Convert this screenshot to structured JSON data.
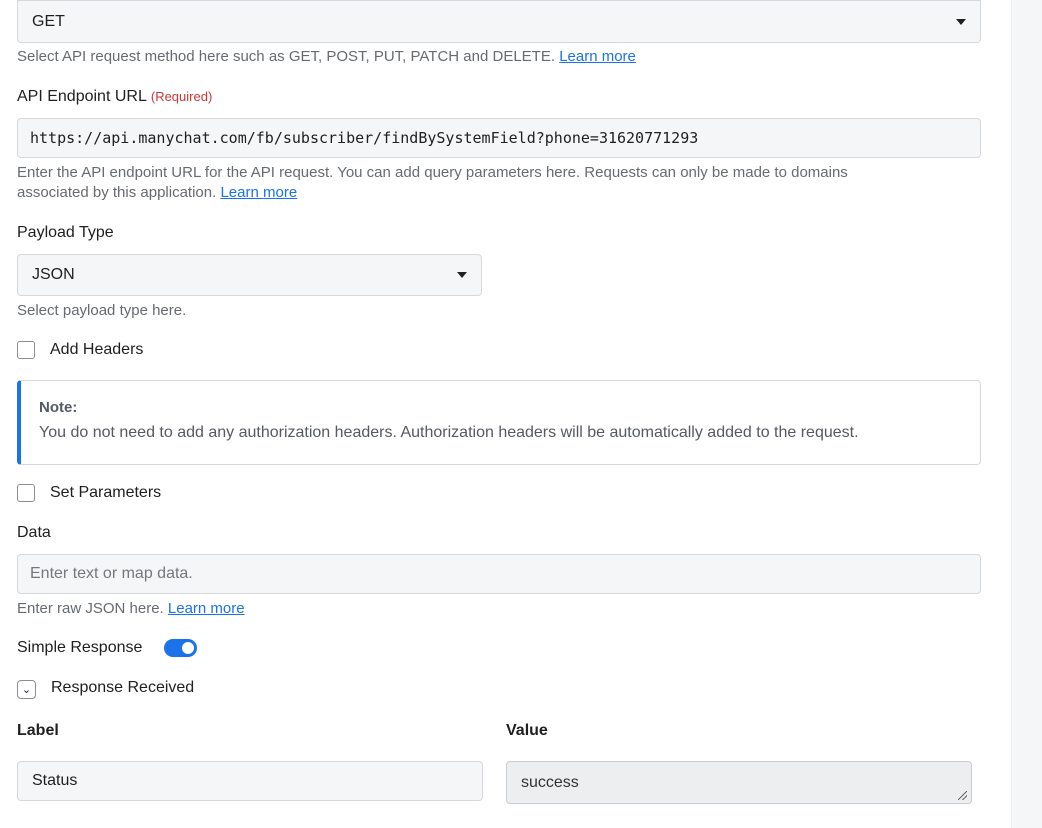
{
  "method": {
    "value": "GET",
    "hint": "Select API request method here such as GET, POST, PUT, PATCH and DELETE.",
    "learn_more": "Learn more"
  },
  "endpoint": {
    "label": "API Endpoint URL",
    "required": "(Required)",
    "value": "https://api.manychat.com/fb/subscriber/findBySystemField?phone=31620771293",
    "hint_line1": "Enter the API endpoint URL for the API request. You can add query parameters here. Requests can only be made to domains",
    "hint_line2": "associated by this application.",
    "learn_more": "Learn more"
  },
  "payload": {
    "label": "Payload Type",
    "value": "JSON",
    "hint": "Select payload type here."
  },
  "add_headers": {
    "label": "Add Headers",
    "checked": false
  },
  "note": {
    "title": "Note:",
    "text": "You do not need to add any authorization headers. Authorization headers will be automatically added to the request."
  },
  "set_parameters": {
    "label": "Set Parameters",
    "checked": false
  },
  "data_field": {
    "label": "Data",
    "placeholder": "Enter text or map data.",
    "hint": "Enter raw JSON here.",
    "learn_more": "Learn more"
  },
  "simple_response": {
    "label": "Simple Response",
    "enabled": true
  },
  "response_received": {
    "label": "Response Received",
    "expanded": true
  },
  "response_table": {
    "label_header": "Label",
    "value_header": "Value",
    "rows": [
      {
        "label": "Status",
        "value": "success"
      }
    ]
  },
  "colors": {
    "accent": "#1a73e8",
    "required": "#d13438"
  }
}
